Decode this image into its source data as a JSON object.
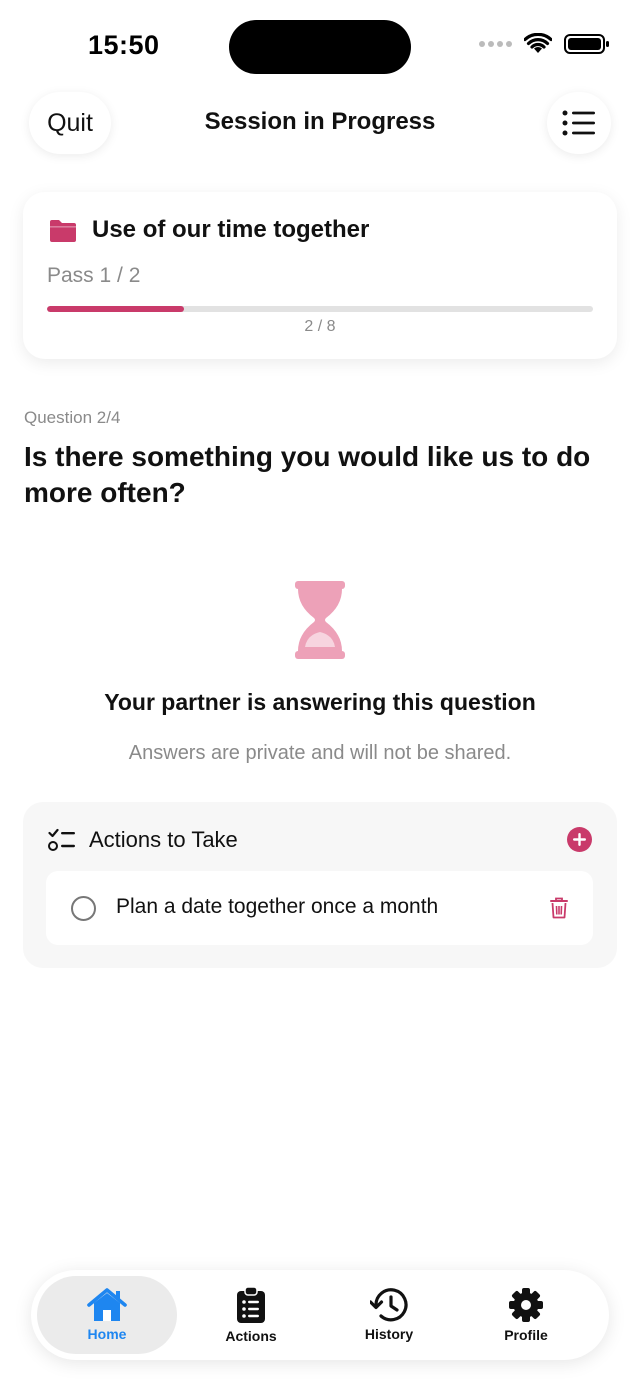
{
  "status_bar": {
    "time": "15:50"
  },
  "header": {
    "quit_label": "Quit",
    "title": "Session in Progress",
    "menu_icon": "list-icon"
  },
  "session": {
    "topic": "Use of our time together",
    "topic_icon": "folder-icon",
    "pass_label": "Pass 1 / 2",
    "progress_text": "2 / 8",
    "progress_fraction": 0.25,
    "accent_color": "#c93a6a"
  },
  "question": {
    "number": "Question 2/4",
    "text": "Is there something you would like us to do more often?"
  },
  "waiting": {
    "icon": "hourglass-icon",
    "title": "Your partner is answering this question",
    "subtitle": "Answers are private and will not be shared."
  },
  "actions": {
    "title": "Actions to Take",
    "items": [
      {
        "text": "Plan a date together once a month",
        "checked": false
      }
    ]
  },
  "tabbar": {
    "tabs": [
      {
        "label": "Home",
        "icon": "home-icon",
        "active": true
      },
      {
        "label": "Actions",
        "icon": "clipboard-icon",
        "active": false
      },
      {
        "label": "History",
        "icon": "history-icon",
        "active": false
      },
      {
        "label": "Profile",
        "icon": "gear-icon",
        "active": false
      }
    ],
    "active_color": "#1e86f0"
  }
}
